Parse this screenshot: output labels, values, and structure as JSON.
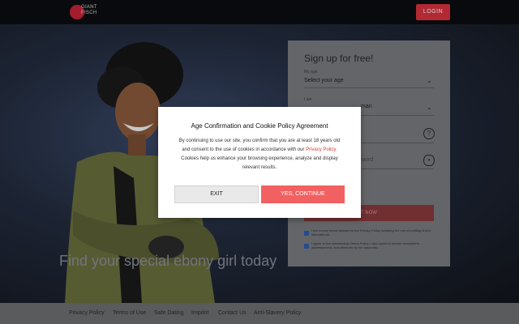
{
  "header": {
    "logo_text": "GIANT FISCH",
    "login_label": "LOGIN"
  },
  "hero": {
    "tagline": "Find your special ebony girl today"
  },
  "signup": {
    "title": "Sign up for free!",
    "age_label": "My age",
    "age_value": "Select your age",
    "gender_label": "I am",
    "gender_value": "man",
    "password_value": "word",
    "start_label": "T NOW",
    "checkbox1": "I am money ebunti allowed to the Privacy Policy including the use of profiling & first international...",
    "checkbox2": "I agree to the membership Terms Policy. I also agree to receive newsletters, advertisement, and offers etc by me automatic"
  },
  "footer": {
    "links": [
      "Privacy Policy",
      "Terms of Use",
      "Safe Dating",
      "Imprint",
      "Contact Us",
      "Anti-Slavery Policy"
    ]
  },
  "modal": {
    "title": "Age Confirmation and Cookie Policy Agreement",
    "body_pre": "By continuing to use our site, you confirm that you are at least 18 years old and consent to the use of cookies in accordance with our",
    "body_link": "Privacy Policy",
    "body_post": ". Cookies help us enhance your browsing experience, analyze and display relevant results.",
    "exit_label": "EXIT",
    "yes_label": "YES, CONTINUE"
  },
  "colors": {
    "accent": "#d8323f",
    "yes_button": "#f16161",
    "link": "#d63a3a"
  }
}
